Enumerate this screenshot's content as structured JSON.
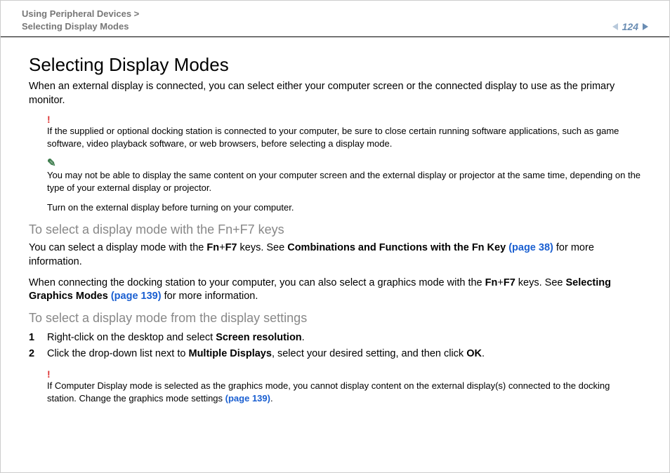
{
  "header": {
    "breadcrumb_line1": "Using Peripheral Devices >",
    "breadcrumb_line2": "Selecting Display Modes",
    "page_number": "124"
  },
  "title": "Selecting Display Modes",
  "intro": "When an external display is connected, you can select either your computer screen or the connected display to use as the primary monitor.",
  "warning1": "If the supplied or optional docking station is connected to your computer, be sure to close certain running software applications, such as game software, video playback software, or web browsers, before selecting a display mode.",
  "memo": "You may not be able to display the same content on your computer screen and the external display or projector at the same time, depending on the type of your external display or projector.",
  "plain_note": "Turn on the external display before turning on your computer.",
  "sub1": "To select a display mode with the Fn+F7 keys",
  "p1a": "You can select a display mode with the ",
  "p1_fn": "Fn",
  "p1_plus": "+",
  "p1_f7": "F7",
  "p1b": " keys. See ",
  "p1_bold_ref": "Combinations and Functions with the Fn Key ",
  "p1_link": "(page 38)",
  "p1c": " for more information.",
  "p2a": "When connecting the docking station to your computer, you can also select a graphics mode with the ",
  "p2b": " keys. See ",
  "p2_bold_ref": "Selecting Graphics Modes ",
  "p2_link": "(page 139)",
  "p2c": " for more information.",
  "sub2": "To select a display mode from the display settings",
  "steps": {
    "n1": "1",
    "s1a": "Right-click on the desktop and select ",
    "s1b": "Screen resolution",
    "s1c": ".",
    "n2": "2",
    "s2a": "Click the drop-down list next to ",
    "s2b": "Multiple Displays",
    "s2c": ", select your desired setting, and then click ",
    "s2d": "OK",
    "s2e": "."
  },
  "warning2a": "If Computer Display mode is selected as the graphics mode, you cannot display content on the external display(s) connected to the docking station. Change the graphics mode settings ",
  "warning2_link": "(page 139)",
  "warning2b": "."
}
